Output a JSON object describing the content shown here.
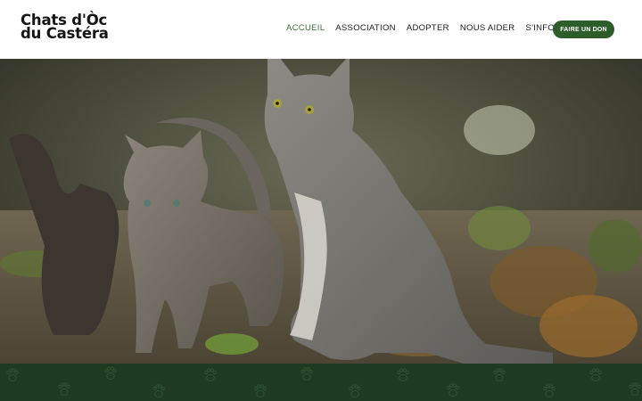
{
  "header": {
    "logo_line1": "Chats d'Òc",
    "logo_line2": "du Castéra",
    "nav": [
      {
        "label": "ACCUEIL",
        "active": true
      },
      {
        "label": "ASSOCIATION",
        "active": false
      },
      {
        "label": "ADOPTER",
        "active": false
      },
      {
        "label": "NOUS AIDER",
        "active": false
      },
      {
        "label": "S'INFORMER",
        "active": false
      }
    ],
    "donate_label": "FAIRE UN DON"
  },
  "hero": {
    "image": "cats-photo",
    "icon": "cats-outdoors"
  },
  "band": {
    "pattern_icon": "paw-print-icon"
  },
  "colors": {
    "accent": "#2d5e2a",
    "nav_active": "#3e6e3b",
    "band_bg": "#1f3a22"
  }
}
